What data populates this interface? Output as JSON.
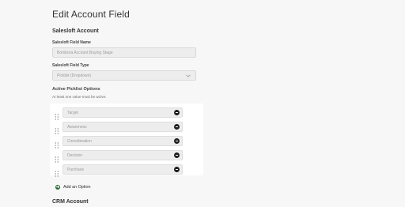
{
  "page": {
    "title": "Edit Account Field"
  },
  "salesloft_account": {
    "heading": "Salesloft Account",
    "field_name_label": "Salesloft Field Name",
    "field_name_value": "Bombora Account Buying Stage",
    "field_type_label": "Salesloft Field Type",
    "field_type_value": "Picklist (Dropdown)",
    "field_type_icon": "chevron-down-icon"
  },
  "picklist": {
    "heading": "Active Picklist Options",
    "helper": "At least one value must be active.",
    "options": [
      {
        "label": "Target"
      },
      {
        "label": "Awareness"
      },
      {
        "label": "Consideration"
      },
      {
        "label": "Decision"
      },
      {
        "label": "Purchase"
      }
    ],
    "add_label": "Add an Option",
    "add_icon_color": "#2f6b3a",
    "remove_icon_color": "#1f1f1f"
  },
  "crm_account": {
    "heading": "CRM Account"
  }
}
